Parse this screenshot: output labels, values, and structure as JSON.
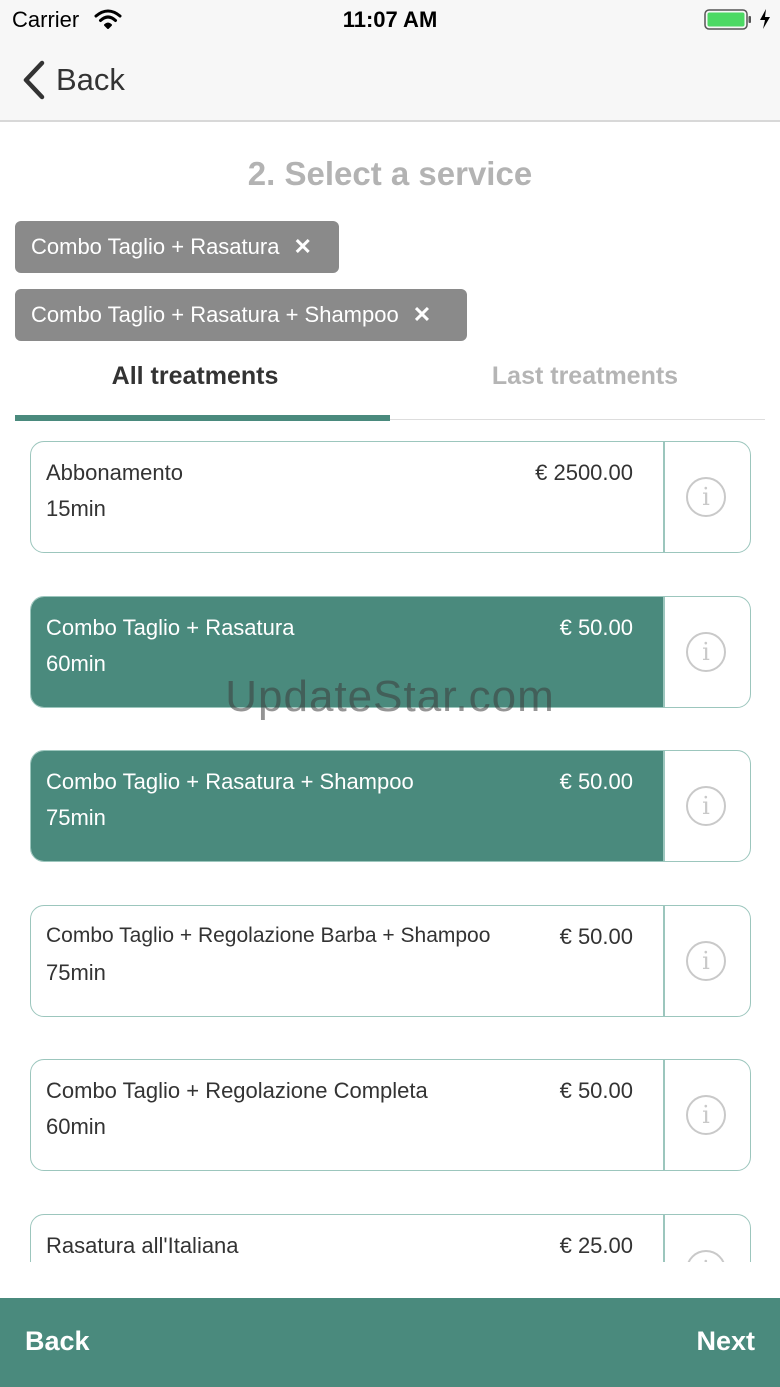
{
  "status_bar": {
    "carrier": "Carrier",
    "time": "11:07 AM",
    "battery_color": "#4cd964"
  },
  "nav": {
    "back_label": "Back"
  },
  "title": "2. Select a service",
  "selected_chips": [
    {
      "label": "Combo Taglio + Rasatura",
      "remove": "✕"
    },
    {
      "label": "Combo Taglio + Rasatura + Shampoo",
      "remove": "✕"
    }
  ],
  "tabs": [
    {
      "label": "All treatments",
      "active": true
    },
    {
      "label": "Last treatments",
      "active": false
    }
  ],
  "services": [
    {
      "name": "Abbonamento",
      "duration": "15min",
      "price": "€ 2500.00",
      "selected": false
    },
    {
      "name": "Combo Taglio + Rasatura",
      "duration": "60min",
      "price": "€ 50.00",
      "selected": true
    },
    {
      "name": "Combo Taglio + Rasatura + Shampoo",
      "duration": "75min",
      "price": "€ 50.00",
      "selected": true
    },
    {
      "name": "Combo Taglio + Regolazione Barba + Shampoo",
      "duration": "75min",
      "price": "€ 50.00",
      "selected": false
    },
    {
      "name": "Combo Taglio + Regolazione Completa",
      "duration": "60min",
      "price": "€ 50.00",
      "selected": false
    },
    {
      "name": "Rasatura all'Italiana",
      "duration": "",
      "price": "€ 25.00",
      "selected": false
    }
  ],
  "info_glyph": "i",
  "watermark": "UpdateStar.com",
  "footer": {
    "back_label": "Back",
    "next_label": "Next"
  },
  "colors": {
    "accent": "#4a8a7d",
    "chip": "#8a8a8a",
    "title_gray": "#b3b3b3"
  }
}
